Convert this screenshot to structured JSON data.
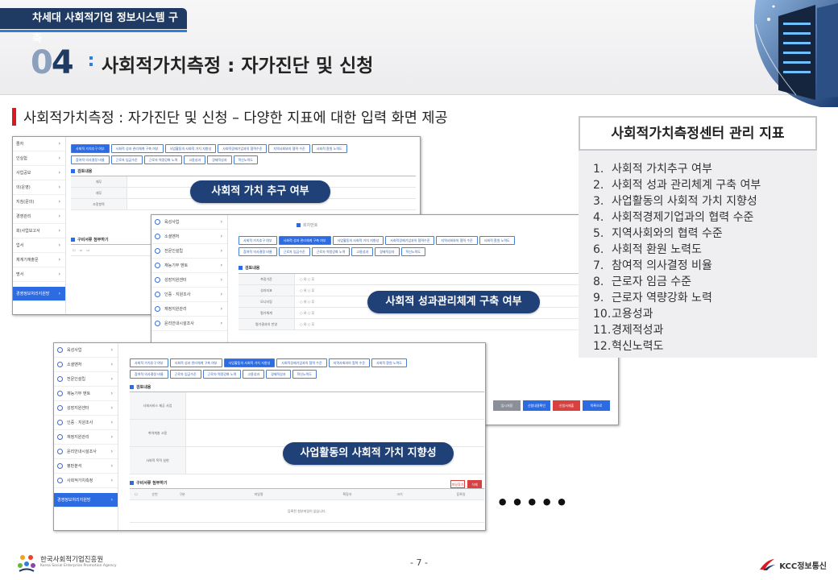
{
  "header": {
    "project_tab": "차세대 사회적기업 정보시스템 구축",
    "section_number": "04",
    "section_title": "사회적가치측정 : 자가진단 및 신청"
  },
  "subheading": "사회적가치측정 : 자가진단 및 신청 – 다양한 지표에 대한 입력 화면 제공",
  "colors": {
    "navy": "#1f3a63",
    "caption_blue": "#1f4178",
    "tab_active": "#2d6be3",
    "accent_red": "#d71920"
  },
  "screenshots": [
    {
      "caption": "사회적 가치 추구 여부",
      "sidebar": [
        "졸자",
        "인실험",
        "사업공모",
        "의(운영)",
        "지침(문의)",
        "경영관리",
        "회(사업보고서",
        "업서",
        "체계기재출문",
        "명서"
      ],
      "sidebar_active": "경영정보처리지원방",
      "tabs_row1": [
        "사회적 가치추구 여부",
        "사회적 성과 관리체계 구축 여부",
        "사업활동의 사회적 가치 지향성",
        "사회적경제기업과의 협력수준",
        "지역사회와의 협력 수준",
        "사회적 환원 노력도"
      ],
      "tabs_row2": [
        "참여적 의사결정 비율",
        "근로자 임금수준",
        "근로자 역량강화 노력",
        "고용성과",
        "경제적성과",
        "혁신노력도"
      ],
      "section": "검토내용",
      "rows": [
        "재무",
        "재무",
        "조정항목"
      ],
      "attach_title": "구비서류 첨부하기"
    },
    {
      "caption": "사회적 성과관리체계 구축 여부",
      "sidebar": [
        "육성사업",
        "소셜벤처",
        "전문인설립",
        "재능기부 멘토",
        "성장지원센터",
        "인증 · 지원조사",
        "재정지원관리",
        "윤리안내시설조사"
      ],
      "tabs_row1": [
        "사회적 가치추구 여부",
        "사회적 성과 관리체계 구축 여부",
        "사업활동의 사회적 가치 지향성",
        "사회적경제기업과의 협력수준",
        "지역사회와의 협력 수준",
        "사회적 환원 노력도"
      ],
      "tabs_row2": [
        "참여적 의사결정 비율",
        "근로자 임금수준",
        "근로자 역량강화 노력",
        "고용성과",
        "경제적성과",
        "혁신노력도"
      ],
      "section": "검토내용",
      "header_label": "회차번호",
      "rows": [
        "측정기준",
        "성과지표",
        "모니터링",
        "평가체계",
        "평가결과의 반영"
      ],
      "radio": "○ 유  ○ 무",
      "buttons": [
        "임시저장",
        "신청내용확인",
        "신청서제출",
        "목록으로"
      ]
    },
    {
      "caption": "사업활동의 사회적 가치 지향성",
      "sidebar": [
        "육성사업",
        "소셜벤처",
        "전문인설립",
        "재능기부 멘토",
        "성장지원센터",
        "인증 · 지원조사",
        "재정지원관리",
        "윤리안내시설조사",
        "평판분석",
        "사회적가치측정"
      ],
      "sidebar_active": "경영정보처리지원방",
      "tabs_row1": [
        "사회적 가치추구 여부",
        "사회적 성과 관리체계 구축 여부",
        "사업활동의 사회적 가치 지향성",
        "사회적경제기업과의 협력 수준",
        "지역사회와의 협력 수준",
        "사회적 환원 노력도"
      ],
      "tabs_row2": [
        "참여적 의사결정 비율",
        "근로자 임금수준",
        "근로자 역량강화 노력",
        "고용성과",
        "경제적성과",
        "혁신노력도"
      ],
      "section": "검토내용",
      "rows": [
        "사회서비스 제공 사업",
        "취약계층 고용",
        "사회적 목적 실현"
      ],
      "attach_title": "구비서류 첨부하기",
      "attach_cols": [
        "순번",
        "구분",
        "파일명",
        "확장자",
        "크기",
        "등록일"
      ],
      "attach_empty": "등록된 첨부파일이 없습니다.",
      "attach_buttons": [
        "파일찾기",
        "삭제"
      ]
    }
  ],
  "panel": {
    "title": "사회적가치측정센터 관리 지표",
    "items": [
      {
        "n": "1.",
        "label": "사회적 가치추구 여부"
      },
      {
        "n": "2.",
        "label": "사회적 성과 관리체계 구축 여부"
      },
      {
        "n": "3.",
        "label": "사업활동의 사회적 가치 지향성"
      },
      {
        "n": "4.",
        "label": "사회적경제기업과의 협력 수준"
      },
      {
        "n": "5.",
        "label": "지역사회와의 협력 수준"
      },
      {
        "n": "6.",
        "label": "사회적 환원 노력도"
      },
      {
        "n": "7.",
        "label": "참여적 의사결정 비율"
      },
      {
        "n": "8.",
        "label": "근로자 임금 수준"
      },
      {
        "n": "9.",
        "label": "근로자 역량강화 노력"
      },
      {
        "n": "10.",
        "label": "고용성과"
      },
      {
        "n": "11.",
        "label": "경제적성과"
      },
      {
        "n": "12.",
        "label": "혁신노력도"
      }
    ]
  },
  "ellipsis": "•••••",
  "footer": {
    "org_name": "한국사회적기업진흥원",
    "org_name_en": "Korea Social Enterprise Promotion Agency",
    "page": "- 7 -",
    "company": "KCC정보통신"
  }
}
